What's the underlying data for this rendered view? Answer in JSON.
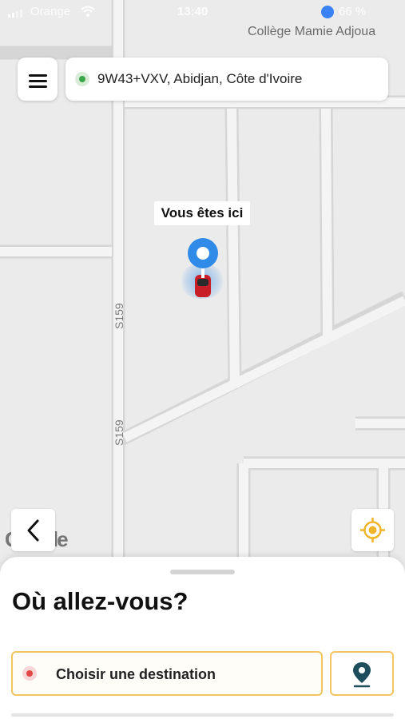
{
  "status_bar": {
    "carrier": "Orange",
    "time": "13:40",
    "battery": "66 %"
  },
  "map": {
    "place_label": "Collège Mamie Adjoua",
    "road_labels": [
      "S159",
      "S159"
    ],
    "attribution": "Google",
    "you_are_here": "Vous êtes ici"
  },
  "header": {
    "address": "9W43+VXV, Abidjan, Côte d'Ivoire"
  },
  "sheet": {
    "title": "Où allez-vous?",
    "destination_placeholder": "Choisir une destination"
  },
  "colors": {
    "accent": "#f2c462",
    "pin_blue": "#2f8ae8",
    "origin_green": "#3aa64a",
    "destination_red": "#e04848",
    "locate_icon": "#f0b429",
    "map_pin_teal": "#1e4d5c"
  },
  "icons": {
    "menu": "hamburger-icon",
    "back": "chevron-left-icon",
    "locate": "crosshair-icon",
    "map_pick": "map-pin-icon"
  }
}
